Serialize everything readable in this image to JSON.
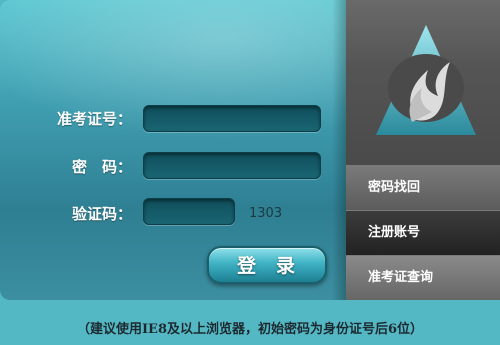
{
  "form": {
    "ticket_label": "准考证号：",
    "password_label": "密　码：",
    "captcha_label": "验证码：",
    "ticket_value": "",
    "password_value": "",
    "captcha_value": "",
    "captcha_code": "1303",
    "login_label": "登录"
  },
  "sidebar": {
    "items": [
      {
        "label": "密码找回"
      },
      {
        "label": "注册账号"
      },
      {
        "label": "准考证查询"
      }
    ]
  },
  "footer": {
    "note": "（建议使用IE8及以上浏览器，初始密码为身份证号后6位）"
  },
  "colors": {
    "panel_teal": "#3f9eb0",
    "background": "#54b8c4",
    "sidebar_gray": "#555555"
  }
}
